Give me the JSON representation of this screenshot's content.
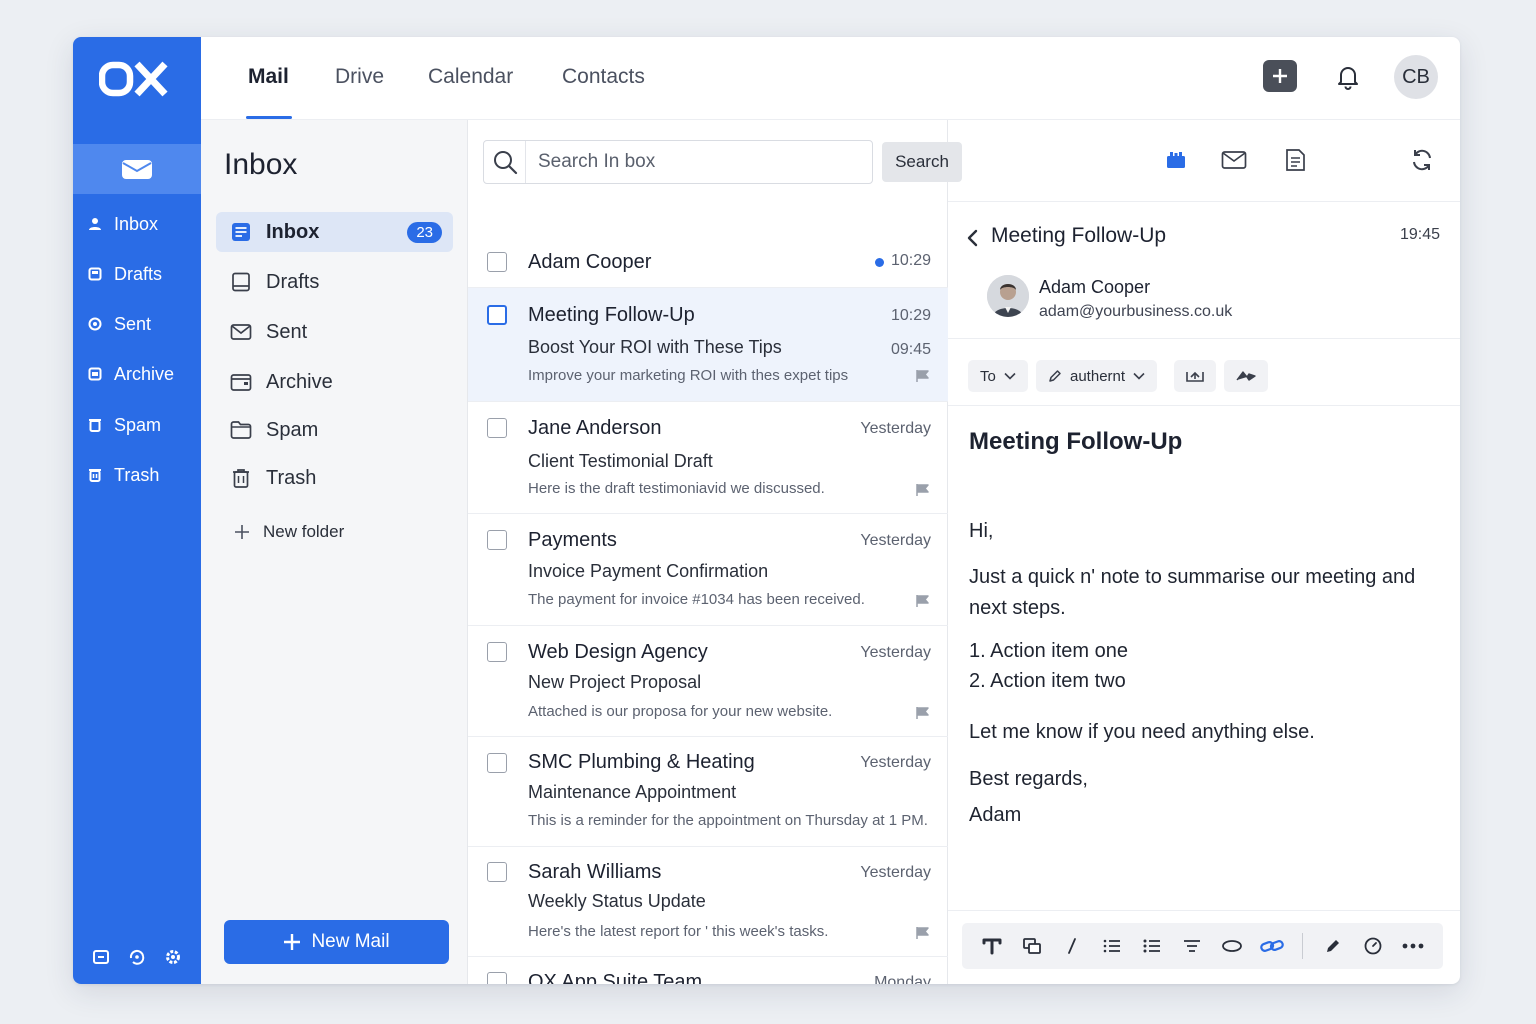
{
  "brand": {
    "logo_text": "OX",
    "accent": "#2a6ce6"
  },
  "rail": {
    "items": [
      {
        "label": "Inbox",
        "icon": "person-icon"
      },
      {
        "label": "Drafts",
        "icon": "drafts-icon"
      },
      {
        "label": "Sent",
        "icon": "sent-icon"
      },
      {
        "label": "Archive",
        "icon": "archive-icon"
      },
      {
        "label": "Spam",
        "icon": "spam-icon"
      },
      {
        "label": "Trash",
        "icon": "trash-icon"
      }
    ]
  },
  "topnav": {
    "tabs": [
      {
        "label": "Mail"
      },
      {
        "label": "Drive"
      },
      {
        "label": "Calendar"
      },
      {
        "label": "Contacts"
      }
    ],
    "avatar_initials": "CB"
  },
  "folders": {
    "title": "Inbox",
    "items": [
      {
        "label": "Inbox",
        "count": "23"
      },
      {
        "label": "Drafts"
      },
      {
        "label": "Sent"
      },
      {
        "label": "Archive"
      },
      {
        "label": "Spam"
      },
      {
        "label": "Trash"
      }
    ],
    "new_folder": "New folder",
    "new_mail": "New Mail"
  },
  "search": {
    "placeholder": "Search In box",
    "button": "Search"
  },
  "messages": [
    {
      "sender": "Adam Cooper",
      "time": "10:29",
      "unread": true
    },
    {
      "sender": "Meeting Follow-Up",
      "time": "10:29",
      "subject": "Boost Your ROI with These Tips",
      "time2": "09:45",
      "preview": "Improve your marketing ROI with thes expet tips"
    },
    {
      "sender": "Jane Anderson",
      "time": "Yesterday",
      "subject": "Client Testimonial Draft",
      "preview": "Here is the draft testimoniavid we discussed."
    },
    {
      "sender": "Payments",
      "time": "Yesterday",
      "subject": "Invoice Payment Confirmation",
      "preview": "The payment for invoice #1034 has been received."
    },
    {
      "sender": "Web Design Agency",
      "time": "Yesterday",
      "subject": "New Project Proposal",
      "preview": "Attached is our proposa for your new website."
    },
    {
      "sender": "SMC Plumbing & Heating",
      "time": "Yesterday",
      "subject": "Maintenance Appointment",
      "preview": "This is a reminder for the appointment on Thursday at 1 PM."
    },
    {
      "sender": "Sarah Williams",
      "time": "Yesterday",
      "subject": "Weekly Status Update",
      "preview": "Here's the latest report for ' this week's tasks."
    },
    {
      "sender": "OX App Suite Team",
      "time": "Monday"
    }
  ],
  "reader": {
    "subject": "Meeting Follow-Up",
    "time": "19:45",
    "from_name": "Adam Cooper",
    "from_email": "adam@yourbusiness.co.uk",
    "chips": {
      "to": "To",
      "author": "authernt"
    },
    "body_title": "Meeting Follow-Up",
    "greeting": "Hi,",
    "para1": "Just a quick n' note to summarise our meeting and next steps.",
    "item1": "1. Action item one",
    "item2": "2. Action item two",
    "para2": "Let me know if you need anything else.",
    "closing": "Best regards,",
    "signature": "Adam"
  }
}
